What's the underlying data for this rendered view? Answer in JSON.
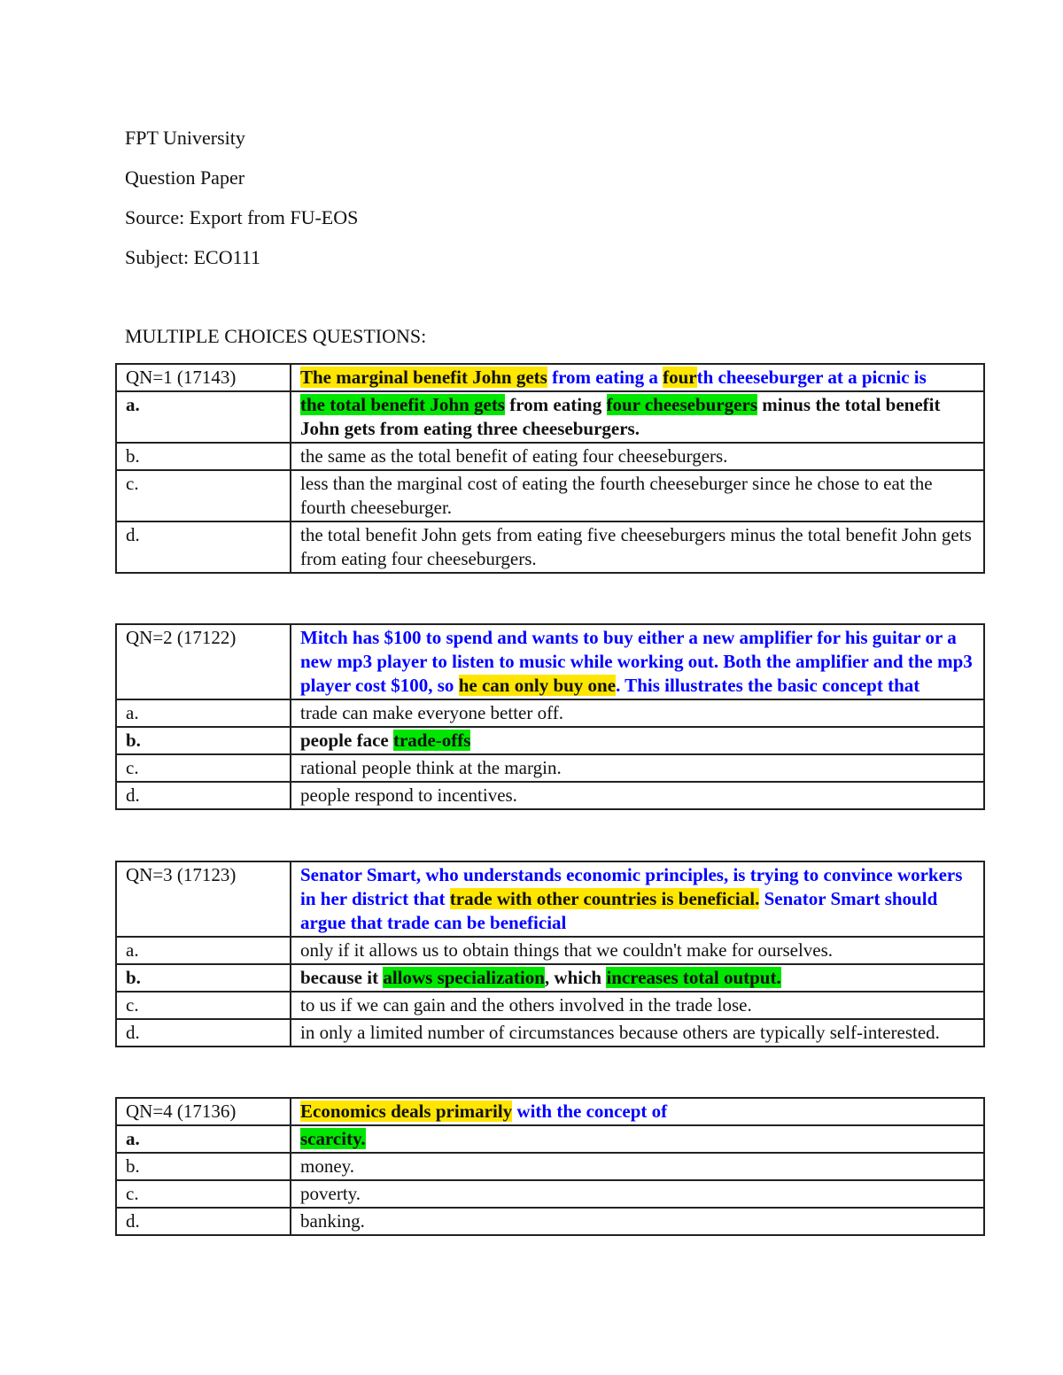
{
  "header": {
    "institution": "FPT University",
    "doc_type": "Question Paper",
    "source": "Source: Export from FU-EOS",
    "subject": "Subject: ECO111",
    "section_title": "MULTIPLE CHOICES QUESTIONS:"
  },
  "colors": {
    "stem_text": "#0000ff",
    "highlight_yellow": "#ffe600",
    "highlight_green": "#00e600"
  },
  "questions": [
    {
      "label": "QN=1 (17143)",
      "stem": [
        {
          "text": "The marginal benefit John gets",
          "hl": "yellow"
        },
        {
          "text": " from eating a ",
          "hl": ""
        },
        {
          "text": "four",
          "hl": "yellow"
        },
        {
          "text": "th cheeseburger at a picnic is",
          "hl": ""
        }
      ],
      "options": [
        {
          "letter": "a.",
          "correct": true,
          "parts": [
            {
              "text": "the total benefit John gets",
              "hl": "green"
            },
            {
              "text": " from eating ",
              "hl": ""
            },
            {
              "text": "four cheeseburgers",
              "hl": "green"
            },
            {
              "text": " minus the total benefit John gets from eating three cheeseburgers.",
              "hl": ""
            }
          ]
        },
        {
          "letter": "b.",
          "correct": false,
          "parts": [
            {
              "text": "the same as the total benefit of eating four cheeseburgers.",
              "hl": ""
            }
          ]
        },
        {
          "letter": "c.",
          "correct": false,
          "parts": [
            {
              "text": "less than the marginal cost of eating the fourth cheeseburger since he chose to eat the fourth cheeseburger.",
              "hl": ""
            }
          ]
        },
        {
          "letter": "d.",
          "correct": false,
          "parts": [
            {
              "text": "the total benefit John gets from eating five cheeseburgers minus the total benefit John gets from eating four cheeseburgers.",
              "hl": ""
            }
          ]
        }
      ]
    },
    {
      "label": "QN=2 (17122)",
      "stem": [
        {
          "text": "Mitch has $100 to spend and wants to buy either a new amplifier for his guitar or a new mp3 player to listen to music while working out.  Both the amplifier and the mp3 player cost $100, so ",
          "hl": ""
        },
        {
          "text": "he can only buy one",
          "hl": "yellow"
        },
        {
          "text": ".  This illustrates the basic concept that",
          "hl": ""
        }
      ],
      "options": [
        {
          "letter": "a.",
          "correct": false,
          "parts": [
            {
              "text": "trade can make everyone better off.",
              "hl": ""
            }
          ]
        },
        {
          "letter": "b.",
          "correct": true,
          "parts": [
            {
              "text": "people face ",
              "hl": ""
            },
            {
              "text": "trade-offs",
              "hl": "green"
            }
          ]
        },
        {
          "letter": "c.",
          "correct": false,
          "parts": [
            {
              "text": "rational people think at the margin.",
              "hl": ""
            }
          ]
        },
        {
          "letter": "d.",
          "correct": false,
          "parts": [
            {
              "text": "people respond to incentives.",
              "hl": ""
            }
          ]
        }
      ]
    },
    {
      "label": "QN=3 (17123)",
      "stem": [
        {
          "text": "Senator Smart, who understands economic principles, is trying to convince workers in her district that ",
          "hl": ""
        },
        {
          "text": "trade with other countries is beneficial.",
          "hl": "yellow"
        },
        {
          "text": " Senator Smart should argue that trade can be beneficial",
          "hl": ""
        }
      ],
      "options": [
        {
          "letter": "a.",
          "correct": false,
          "parts": [
            {
              "text": "only if it allows us to obtain things that we couldn't make for ourselves.",
              "hl": ""
            }
          ]
        },
        {
          "letter": "b.",
          "correct": true,
          "parts": [
            {
              "text": "because it ",
              "hl": ""
            },
            {
              "text": "allows specialization",
              "hl": "green"
            },
            {
              "text": ", which ",
              "hl": ""
            },
            {
              "text": "increases total output.",
              "hl": "green"
            }
          ]
        },
        {
          "letter": "c.",
          "correct": false,
          "parts": [
            {
              "text": "to us if we can gain and the others involved in the trade lose.",
              "hl": ""
            }
          ]
        },
        {
          "letter": "d.",
          "correct": false,
          "parts": [
            {
              "text": "in only a limited number of circumstances because others are typically self-interested.",
              "hl": ""
            }
          ]
        }
      ]
    },
    {
      "label": "QN=4 (17136)",
      "stem": [
        {
          "text": "Economics deals primarily",
          "hl": "yellow"
        },
        {
          "text": " with the concept of",
          "hl": ""
        }
      ],
      "options": [
        {
          "letter": "a.",
          "correct": true,
          "parts": [
            {
              "text": "scarcity.",
              "hl": "green"
            }
          ]
        },
        {
          "letter": "b.",
          "correct": false,
          "parts": [
            {
              "text": "money.",
              "hl": ""
            }
          ]
        },
        {
          "letter": "c.",
          "correct": false,
          "parts": [
            {
              "text": "poverty.",
              "hl": ""
            }
          ]
        },
        {
          "letter": "d.",
          "correct": false,
          "parts": [
            {
              "text": "banking.",
              "hl": ""
            }
          ]
        }
      ]
    }
  ]
}
